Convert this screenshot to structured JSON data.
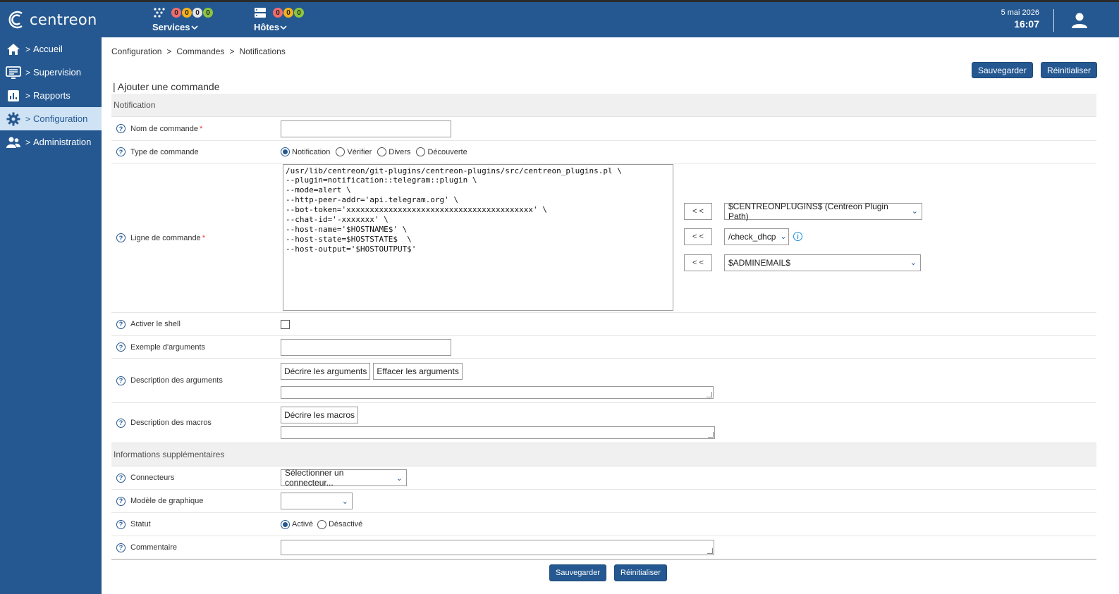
{
  "header": {
    "logo_text": "centreon",
    "services": {
      "label": "Services",
      "counts": [
        "0",
        "0",
        "0",
        "0"
      ]
    },
    "hosts": {
      "label": "Hôtes",
      "counts": [
        "0",
        "0",
        "0"
      ]
    },
    "date": "5 mai 2026",
    "time": "16:07"
  },
  "sidebar": {
    "items": [
      {
        "label": "Accueil",
        "icon": "home-icon"
      },
      {
        "label": "Supervision",
        "icon": "monitor-icon"
      },
      {
        "label": "Rapports",
        "icon": "chart-icon"
      },
      {
        "label": "Configuration",
        "icon": "gear-icon",
        "active": true
      },
      {
        "label": "Administration",
        "icon": "users-icon"
      }
    ]
  },
  "breadcrumb": [
    "Configuration",
    "Commandes",
    "Notifications"
  ],
  "buttons": {
    "save": "Sauvegarder",
    "reset": "Réinitialiser"
  },
  "page_title": "| Ajouter une commande",
  "form": {
    "section_notification": "Notification",
    "nom_label": "Nom de commande",
    "nom_value": "",
    "type_label": "Type de commande",
    "type_options": [
      "Notification",
      "Vérifier",
      "Divers",
      "Découverte"
    ],
    "type_selected": "Notification",
    "cmd_label": "Ligne de commande",
    "cmd_value": "/usr/lib/centreon/git-plugins/centreon-plugins/src/centreon_plugins.pl \\\n--plugin=notification::telegram::plugin \\\n--mode=alert \\\n--http-peer-addr='api.telegram.org' \\\n--bot-token='xxxxxxxxxxxxxxxxxxxxxxxxxxxxxxxxxxxxxxxx' \\\n--chat-id='-xxxxxxx' \\\n--host-name='$HOSTNAME$' \\\n--host-state=$HOSTSTATE$  \\\n--host-output='$HOSTOUTPUT$'",
    "insert_btn": "< <",
    "macro_select_1": "$CENTREONPLUGINS$ (Centreon Plugin Path)",
    "macro_select_2": "/check_dhcp",
    "macro_select_3": "$ADMINEMAIL$",
    "info_icon_glyph": "i",
    "shell_label": "Activer le shell",
    "example_label": "Exemple d'arguments",
    "args_desc_label": "Description des arguments",
    "describe_args_btn": "Décrire les arguments",
    "clear_args_btn": "Effacer les arguments",
    "macros_desc_label": "Description des macros",
    "describe_macros_btn": "Décrire les macros",
    "section_info": "Informations supplémentaires",
    "connectors_label": "Connecteurs",
    "connectors_value": "Sélectionner un connecteur...",
    "graph_label": "Modèle de graphique",
    "graph_value": "",
    "status_label": "Statut",
    "status_options": [
      "Activé",
      "Désactivé"
    ],
    "status_selected": "Activé",
    "comment_label": "Commentaire",
    "required_mark": "*",
    "help_glyph": "?"
  }
}
